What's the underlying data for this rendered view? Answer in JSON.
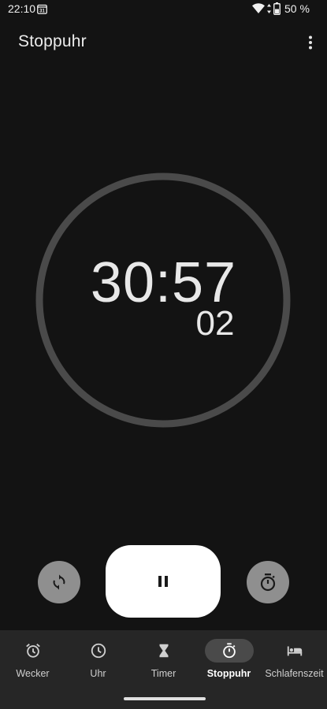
{
  "status_bar": {
    "time": "22:10",
    "calendar_day": "31",
    "battery": "50 %"
  },
  "app_bar": {
    "title": "Stoppuhr",
    "menu_icon": "more-vert-icon"
  },
  "stopwatch": {
    "elapsed": "30:57",
    "hundredths": "02",
    "state": "running"
  },
  "controls": {
    "reset_icon": "reset-icon",
    "pause_icon": "pause-icon",
    "lap_icon": "lap-timer-icon"
  },
  "nav": {
    "items": [
      {
        "label": "Wecker",
        "icon": "alarm-icon",
        "active": false
      },
      {
        "label": "Uhr",
        "icon": "clock-icon",
        "active": false
      },
      {
        "label": "Timer",
        "icon": "hourglass-icon",
        "active": false
      },
      {
        "label": "Stoppuhr",
        "icon": "stopwatch-icon",
        "active": true
      },
      {
        "label": "Schlafenszeit",
        "icon": "bed-icon",
        "active": false
      }
    ]
  },
  "colors": {
    "background": "#131313",
    "nav_background": "#262626",
    "ring": "#4a4a4a",
    "side_button": "#8f8f8f",
    "primary_button": "#ffffff"
  }
}
